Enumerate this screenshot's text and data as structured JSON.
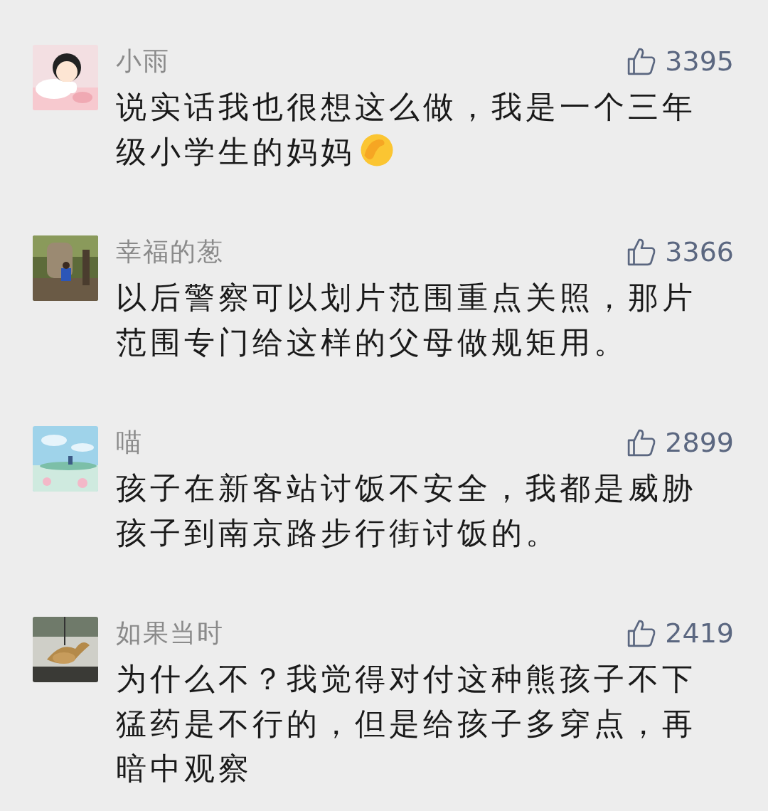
{
  "comments": [
    {
      "name": "小雨",
      "likes": "3395",
      "text": "说实话我也很想这么做，我是一个三年级小学生的妈妈",
      "emoji": true
    },
    {
      "name": "幸福的葱",
      "likes": "3366",
      "text": "以后警察可以划片范围重点关照，那片范围专门给这样的父母做规矩用。",
      "emoji": false
    },
    {
      "name": "喵",
      "likes": "2899",
      "text": "孩子在新客站讨饭不安全，我都是威胁孩子到南京路步行街讨饭的。",
      "emoji": false
    },
    {
      "name": "如果当时",
      "likes": "2419",
      "text": "为什么不？我觉得对付这种熊孩子不下猛药是不行的，但是给孩子多穿点，再暗中观察",
      "emoji": false
    }
  ]
}
